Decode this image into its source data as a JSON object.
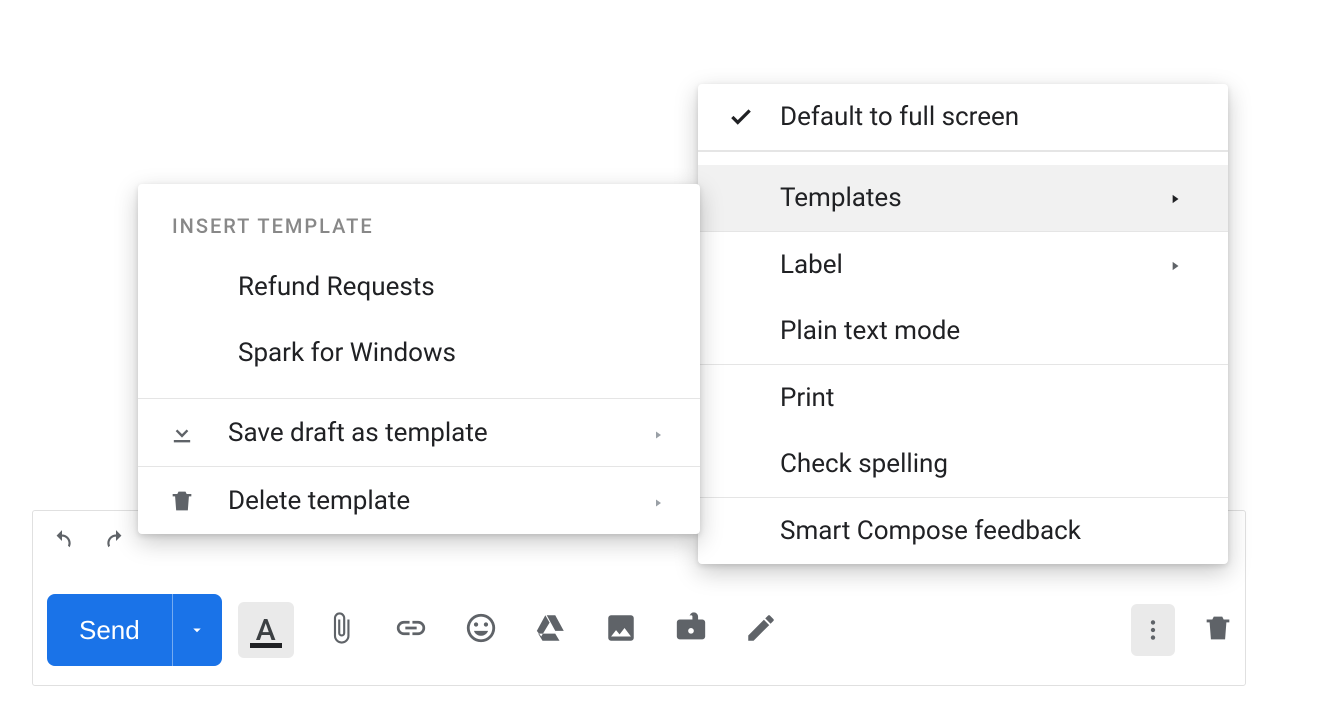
{
  "toolbar": {
    "send_label": "Send"
  },
  "menu": {
    "default_full_screen": "Default to full screen",
    "templates": "Templates",
    "label": "Label",
    "plain_text": "Plain text mode",
    "print": "Print",
    "check_spelling": "Check spelling",
    "smart_compose_feedback": "Smart Compose feedback"
  },
  "submenu": {
    "header": "INSERT TEMPLATE",
    "items": [
      "Refund Requests",
      "Spark for Windows"
    ],
    "save_draft": "Save draft as template",
    "delete_template": "Delete template"
  }
}
